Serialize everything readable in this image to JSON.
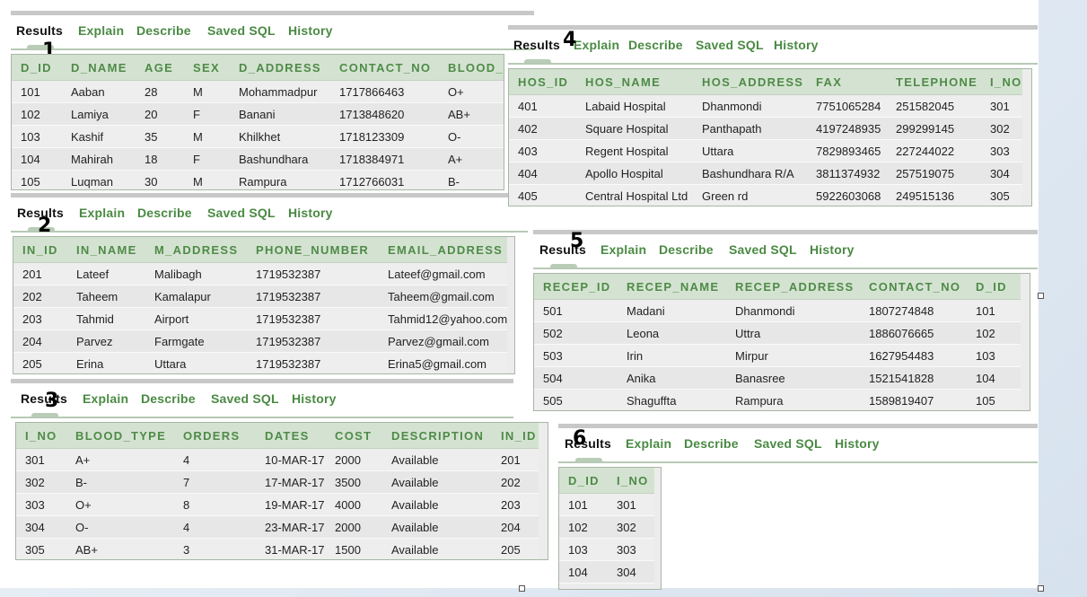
{
  "tab_labels": [
    "Results",
    "Explain",
    "Describe",
    "Saved SQL",
    "History"
  ],
  "panels": [
    {
      "number": "1",
      "columns": [
        "D_ID",
        "D_NAME",
        "AGE",
        "SEX",
        "D_ADDRESS",
        "CONTACT_NO",
        "BLOOD_"
      ],
      "rows": [
        [
          "101",
          "Aaban",
          "28",
          "M",
          "Mohammadpur",
          "1717866463",
          "O+"
        ],
        [
          "102",
          "Lamiya",
          "20",
          "F",
          "Banani",
          "1713848620",
          "AB+"
        ],
        [
          "103",
          "Kashif",
          "35",
          "M",
          "Khilkhet",
          "1718123309",
          "O-"
        ],
        [
          "104",
          "Mahirah",
          "18",
          "F",
          "Bashundhara",
          "1718384971",
          "A+"
        ],
        [
          "105",
          "Luqman",
          "30",
          "M",
          "Rampura",
          "1712766031",
          "B-"
        ]
      ]
    },
    {
      "number": "2",
      "columns": [
        "IN_ID",
        "IN_NAME",
        "M_ADDRESS",
        "PHONE_NUMBER",
        "EMAIL_ADDRESS"
      ],
      "rows": [
        [
          "201",
          "Lateef",
          "Malibagh",
          "1719532387",
          "Lateef@gmail.com"
        ],
        [
          "202",
          "Taheem",
          "Kamalapur",
          "1719532387",
          "Taheem@gmail.com"
        ],
        [
          "203",
          "Tahmid",
          "Airport",
          "1719532387",
          "Tahmid12@yahoo.com"
        ],
        [
          "204",
          "Parvez",
          "Farmgate",
          "1719532387",
          "Parvez@gmail.com"
        ],
        [
          "205",
          "Erina",
          "Uttara",
          "1719532387",
          "Erina5@gmail.com"
        ]
      ]
    },
    {
      "number": "3",
      "columns": [
        "I_NO",
        "BLOOD_TYPE",
        "ORDERS",
        "DATES",
        "COST",
        "DESCRIPTION",
        "IN_ID"
      ],
      "rows": [
        [
          "301",
          "A+",
          "4",
          "10-MAR-17",
          "2000",
          "Available",
          "201"
        ],
        [
          "302",
          "B-",
          "7",
          "17-MAR-17",
          "3500",
          "Available",
          "202"
        ],
        [
          "303",
          "O+",
          "8",
          "19-MAR-17",
          "4000",
          "Available",
          "203"
        ],
        [
          "304",
          "O-",
          "4",
          "23-MAR-17",
          "2000",
          "Available",
          "204"
        ],
        [
          "305",
          "AB+",
          "3",
          "31-MAR-17",
          "1500",
          "Available",
          "205"
        ]
      ]
    },
    {
      "number": "4",
      "columns": [
        "HOS_ID",
        "HOS_NAME",
        "HOS_ADDRESS",
        "FAX",
        "TELEPHONE",
        "I_NO"
      ],
      "rows": [
        [
          "401",
          "Labaid Hospital",
          "Dhanmondi",
          "7751065284",
          "251582045",
          "301"
        ],
        [
          "402",
          "Square Hospital",
          "Panthapath",
          "4197248935",
          "299299145",
          "302"
        ],
        [
          "403",
          "Regent Hospital",
          "Uttara",
          "7829893465",
          "227244022",
          "303"
        ],
        [
          "404",
          "Apollo Hospital",
          "Bashundhara R/A",
          "3811374932",
          "257519075",
          "304"
        ],
        [
          "405",
          "Central Hospital Ltd",
          "Green rd",
          "5922603068",
          "249515136",
          "305"
        ]
      ]
    },
    {
      "number": "5",
      "columns": [
        "RECEP_ID",
        "RECEP_NAME",
        "RECEP_ADDRESS",
        "CONTACT_NO",
        "D_ID"
      ],
      "rows": [
        [
          "501",
          "Madani",
          "Dhanmondi",
          "1807274848",
          "101"
        ],
        [
          "502",
          "Leona",
          "Uttra",
          "1886076665",
          "102"
        ],
        [
          "503",
          "Irin",
          "Mirpur",
          "1627954483",
          "103"
        ],
        [
          "504",
          "Anika",
          "Banasree",
          "1521541828",
          "104"
        ],
        [
          "505",
          "Shaguffta",
          "Rampura",
          "1589819407",
          "105"
        ]
      ]
    },
    {
      "number": "6",
      "columns": [
        "D_ID",
        "I_NO"
      ],
      "rows": [
        [
          "101",
          "301"
        ],
        [
          "102",
          "302"
        ],
        [
          "103",
          "303"
        ],
        [
          "104",
          "304"
        ]
      ]
    }
  ]
}
